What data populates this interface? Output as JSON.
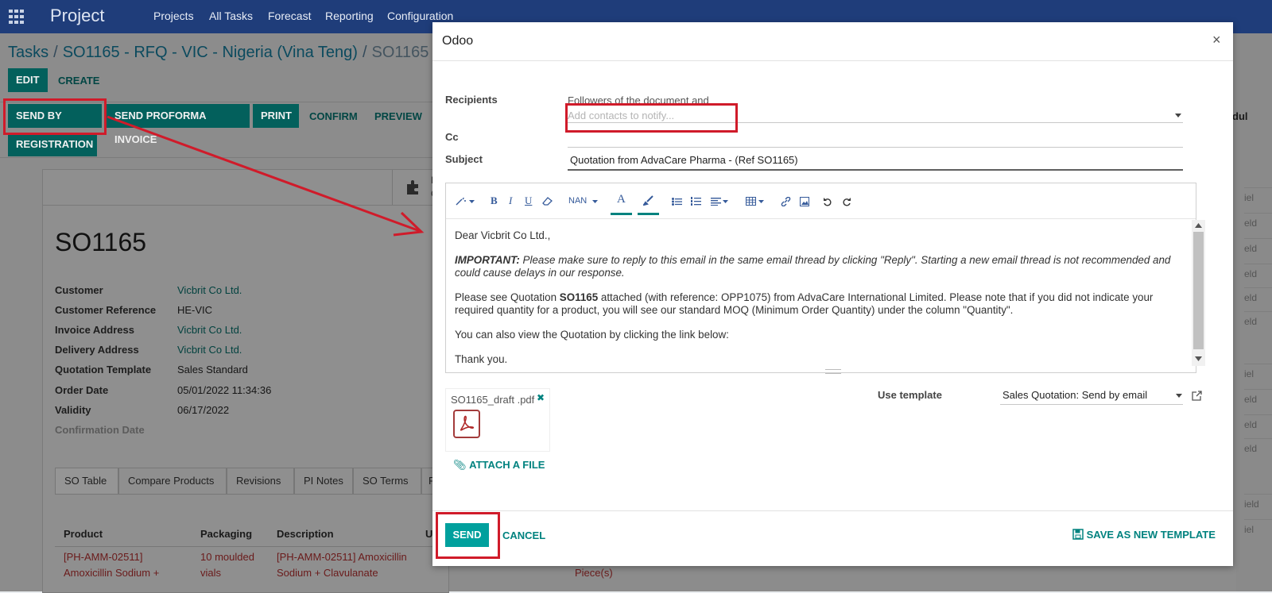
{
  "navbar": {
    "app_name": "Project",
    "menu": [
      "Projects",
      "All Tasks",
      "Forecast",
      "Reporting",
      "Configuration"
    ]
  },
  "breadcrumb": {
    "items": [
      "Tasks",
      "SO1165 - RFQ - VIC - Nigeria (Vina Teng)",
      "SO1165"
    ],
    "separator": "/"
  },
  "control_panel": {
    "edit": "EDIT",
    "create": "CREATE"
  },
  "status_bar": {
    "send_by_email": "SEND BY EMAIL",
    "send_proforma": "SEND PROFORMA INVOICE",
    "print": "PRINT",
    "confirm": "CONFIRM",
    "preview": "PREVIEW",
    "registration": "REGISTRATION"
  },
  "record": {
    "name": "SO1165",
    "fields": [
      {
        "label": "Customer",
        "value": "Vicbrit Co Ltd."
      },
      {
        "label": "Customer Reference",
        "value": "HE-VIC"
      },
      {
        "label": "Invoice Address",
        "value": "Vicbrit Co Ltd."
      },
      {
        "label": "Delivery Address",
        "value": "Vicbrit Co Ltd."
      },
      {
        "label": "Quotation Template",
        "value": "Sales Standard"
      },
      {
        "label": "Order Date",
        "value": "05/01/2022 11:34:36"
      },
      {
        "label": "Validity",
        "value": "06/17/2022"
      },
      {
        "label": "Confirmation Date",
        "value": ""
      }
    ],
    "tabs": [
      "SO Table",
      "Compare Products",
      "Revisions",
      "PI Notes",
      "SO Terms",
      "P"
    ],
    "table": {
      "headers": [
        "Product",
        "Packaging",
        "Description",
        "U"
      ],
      "row": {
        "product_line1": "[PH-AMM-02511]",
        "product_line2": "Amoxicillin Sodium +",
        "packaging_line1": "10 moulded",
        "packaging_line2": "vials",
        "description_line1": "[PH-AMM-02511] Amoxicillin",
        "description_line2": "Sodium + Clavulanate",
        "unit": "Piece(s)"
      }
    },
    "stat_button_line1": "P",
    "stat_button_line2": "C"
  },
  "right_edge": {
    "header_text": "dul",
    "cells": [
      "iel",
      "eld",
      "eld",
      "eld",
      "eld",
      "eld",
      "iel",
      "eld",
      "eld",
      "eld",
      "ield",
      "iel"
    ]
  },
  "modal": {
    "title": "Odoo",
    "close": "×",
    "recipients_label": "Recipients",
    "recipients_hint": "Followers of the document and",
    "recipients_placeholder": "Add contacts to notify...",
    "cc_label": "Cc",
    "subject_label": "Subject",
    "subject_value": "Quotation from AdvaCare Pharma - (Ref SO1165)",
    "toolbar": {
      "font_size": "NAN"
    },
    "body": {
      "greeting": "Dear Vicbrit Co Ltd.,",
      "important_bold": "IMPORTANT:",
      "important_text": " Please make sure to reply to this email in the same email thread by clicking \"Reply\". Starting a new email thread is not recommended and could cause delays in our response.",
      "p2_before": "Please see Quotation ",
      "p2_bold": "SO1165",
      "p2_after": " attached (with reference: OPP1075) from AdvaCare International Limited. Please note that if you did not indicate your required quantity for a product, you will see our standard MOQ (Minimum Order Quantity) under the column \"Quantity\".",
      "p3": "You can also view the Quotation by clicking the link below:",
      "p4": "Thank you."
    },
    "attachment": {
      "filename": "SO1165_draft .pdf",
      "remove": "✖"
    },
    "attach_file": "ATTACH A FILE",
    "use_template_label": "Use template",
    "template_value": "Sales Quotation: Send by email",
    "send": "SEND",
    "cancel": "CANCEL",
    "save_template": "SAVE AS NEW TEMPLATE"
  },
  "colors": {
    "navbar": "#1f3d7a",
    "teal_primary": "#00a09d",
    "highlight_red": "#d01b2a"
  }
}
